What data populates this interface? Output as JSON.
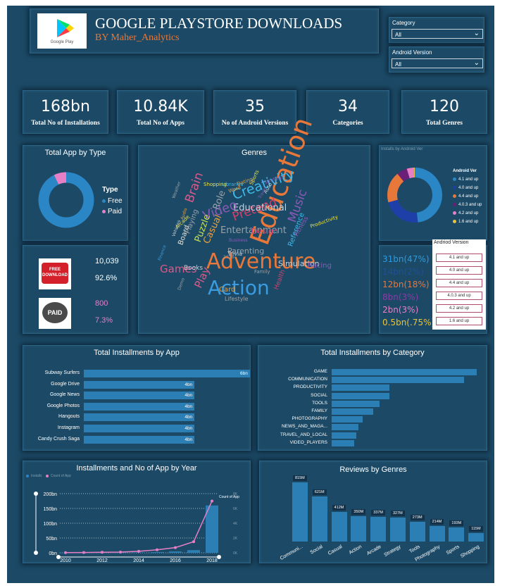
{
  "header": {
    "title": "GOOGLE PLAYSTORE DOWNLOADS",
    "subtitle": "BY Maher_Analytics",
    "logo_text": "Google Play"
  },
  "slicers": {
    "category_label": "Category",
    "category_value": "All",
    "android_label": "Android Version",
    "android_value": "All"
  },
  "kpis": [
    {
      "value": "168bn",
      "label": "Total No of Installations"
    },
    {
      "value": "10.84K",
      "label": "Total No of Apps"
    },
    {
      "value": "35",
      "label": "No of Android Versions"
    },
    {
      "value": "34",
      "label": "Categories"
    },
    {
      "value": "120",
      "label": "Total Genres"
    }
  ],
  "app_type": {
    "title": "Total App by Type",
    "legend_title": "Type",
    "free_label": "Free",
    "paid_label": "Paid",
    "free_color": "#2b86c5",
    "paid_color": "#e77fc7",
    "free_count": "10,039",
    "free_pct": "92.6%",
    "paid_count": "800",
    "paid_pct": "7.3%",
    "free_badge": "FREE DOWNLOAD",
    "paid_badge": "PAID"
  },
  "genres": {
    "title": "Genres",
    "words": [
      {
        "t": "Education",
        "c": "#e8773a"
      },
      {
        "t": "Adventure",
        "c": "#e8773a"
      },
      {
        "t": "Action",
        "c": "#3a9be0"
      },
      {
        "t": "Creativity",
        "c": "#3fb8e8"
      },
      {
        "t": "Pretend",
        "c": "#d63f6a"
      },
      {
        "t": "Educational",
        "c": "#c8d0d8"
      },
      {
        "t": "Video",
        "c": "#8a5ab8"
      },
      {
        "t": "Brain",
        "c": "#d85a8a"
      },
      {
        "t": "Games",
        "c": "#d85a8a"
      },
      {
        "t": "Play",
        "c": "#d85a8a"
      },
      {
        "t": "Entertainment",
        "c": "#9aa0a8"
      },
      {
        "t": "Music",
        "c": "#8a5ab8"
      },
      {
        "t": "Puzzle",
        "c": "#c8e050"
      },
      {
        "t": "Simulation",
        "c": "#c8d0d8"
      },
      {
        "t": "Casual",
        "c": "#e8a040"
      },
      {
        "t": "Role",
        "c": "#9aa0a8"
      },
      {
        "t": "Board",
        "c": "#e8e0d0"
      },
      {
        "t": "Playing",
        "c": "#9aa0a8"
      },
      {
        "t": "Parenting",
        "c": "#9aa0a8"
      },
      {
        "t": "Design",
        "c": "#d63f6a"
      },
      {
        "t": "Books",
        "c": "#c8d0d8"
      },
      {
        "t": "Racing",
        "c": "#8a5ab8"
      },
      {
        "t": "Reference",
        "c": "#3fb8e8"
      },
      {
        "t": "Fitness",
        "c": "#8a5ab8"
      },
      {
        "t": "Card",
        "c": "#e8a040"
      },
      {
        "t": "Lifestyle",
        "c": "#9aa0a8"
      },
      {
        "t": "Health",
        "c": "#d63f6a"
      },
      {
        "t": "Productivity",
        "c": "#e8e050"
      },
      {
        "t": "Trivia",
        "c": "#c8d0d8"
      },
      {
        "t": "Word",
        "c": "#e8a040"
      },
      {
        "t": "Shopping",
        "c": "#e8e050"
      },
      {
        "t": "Libraries",
        "c": "#3fb8e8"
      },
      {
        "t": "Dating",
        "c": "#e8a040"
      },
      {
        "t": "Sports",
        "c": "#e8e050"
      },
      {
        "t": "Strategy",
        "c": "#8a5ab8"
      },
      {
        "t": "Auto",
        "c": "#c8d0d8"
      },
      {
        "t": "Family",
        "c": "#9aa0a8"
      },
      {
        "t": "Arcade",
        "c": "#e8e050"
      },
      {
        "t": "Audio",
        "c": "#e8a040"
      },
      {
        "t": "Vehicles",
        "c": "#c8d0d8"
      },
      {
        "t": "Demo",
        "c": "#9aa0a8"
      },
      {
        "t": "Business",
        "c": "#8a5ab8"
      },
      {
        "t": "Travel",
        "c": "#8a5ab8"
      },
      {
        "t": "Finance",
        "c": "#3a9be0"
      },
      {
        "t": "Weather",
        "c": "#9aa0a8"
      },
      {
        "t": "2018",
        "c": "#9aa0a8"
      }
    ]
  },
  "android_donut": {
    "title": "Installs by Android Ver",
    "legend_title": "Android Ver",
    "items": [
      {
        "label": "4.1 and up",
        "color": "#2b86c5",
        "value": 47
      },
      {
        "label": "4.0 and up",
        "color": "#1f3fa8",
        "value": 22
      },
      {
        "label": "4.4 and up",
        "color": "#e8773a",
        "value": 18
      },
      {
        "label": "4.0.3 and up",
        "color": "#6a1f78",
        "value": 6
      },
      {
        "label": "4.2 and up",
        "color": "#e77fc7",
        "value": 4
      },
      {
        "label": "1.6 and up",
        "color": "#e8c43a",
        "value": 0.75
      }
    ]
  },
  "android_slicer": {
    "title": "Andriod Version",
    "options": [
      "4.1 and up",
      "4.0 and up",
      "4.4 and up",
      "4.0.3 and up",
      "4.2 and up",
      "1.6 and up"
    ]
  },
  "android_shares": [
    {
      "text": "31bn(47%)",
      "color": "#2b9be0"
    },
    {
      "text": "14bn(2%)",
      "color": "#1f4f9a"
    },
    {
      "text": "12bn(18%)",
      "color": "#e8773a"
    },
    {
      "text": "8bn(3%)",
      "color": "#8a3aa8"
    },
    {
      "text": "2bn(3%)",
      "color": "#e77fc7"
    },
    {
      "text": "0.5bn(.75%)",
      "color": "#e8c43a"
    }
  ],
  "chart_data": [
    {
      "type": "bar",
      "orientation": "horizontal",
      "title": "Total Installments by App",
      "categories": [
        "Subway Surfers",
        "Google Drive",
        "Google News",
        "Google Photos",
        "Hangouts",
        "Instagram",
        "Candy Crush Saga"
      ],
      "values": [
        6,
        4,
        4,
        4,
        4,
        4,
        4
      ],
      "value_labels": [
        "6bn",
        "4bn",
        "4bn",
        "4bn",
        "4bn",
        "4bn",
        "4bn"
      ],
      "xlim": [
        0,
        6
      ]
    },
    {
      "type": "bar",
      "orientation": "horizontal",
      "title": "Total Installments by Category",
      "categories": [
        "GAME",
        "COMMUNICATION",
        "PRODUCTIVITY",
        "SOCIAL",
        "TOOLS",
        "FAMILY",
        "PHOTOGRAPHY",
        "NEWS_AND_MAGA...",
        "TRAVEL_AND_LOCAL",
        "VIDEO_PLAYERS"
      ],
      "values": [
        35,
        32,
        14,
        14,
        11.5,
        10,
        7.5,
        6.5,
        6,
        5.5
      ],
      "xlim": [
        0,
        35
      ]
    },
    {
      "type": "bar",
      "title": "Installments and No of App by Year",
      "legend": [
        "Installs",
        "Count of App"
      ],
      "x": [
        2010,
        2011,
        2012,
        2013,
        2014,
        2015,
        2016,
        2017,
        2018
      ],
      "installs": [
        0.3,
        0.5,
        0.6,
        0.9,
        1.3,
        2.2,
        4.5,
        9,
        160
      ],
      "count_of_app": [
        20,
        30,
        70,
        100,
        200,
        400,
        700,
        1500,
        7000
      ],
      "yticks": [
        "0bn",
        "50bn",
        "100bn",
        "150bn",
        "200bn"
      ],
      "y2ticks": [
        "0K",
        "2K",
        "4K",
        "6K",
        "8K"
      ],
      "xticks": [
        "2010",
        "2012",
        "2014",
        "2016",
        "2018"
      ],
      "ylim": [
        0,
        200
      ],
      "y2lim": [
        0,
        8000
      ],
      "annotation": "Count of App"
    },
    {
      "type": "bar",
      "title": "Reviews by Genres",
      "categories": [
        "Communi...",
        "Social",
        "Casual",
        "Action",
        "Arcade",
        "Strategy",
        "Tools",
        "Photography",
        "Sports",
        "Shopping"
      ],
      "values": [
        815,
        621,
        412,
        350,
        337,
        327,
        273,
        214,
        193,
        115
      ],
      "value_labels": [
        "815M",
        "621M",
        "412M",
        "350M",
        "337M",
        "327M",
        "273M",
        "214M",
        "193M",
        "115M"
      ],
      "ylim": [
        0,
        815
      ]
    }
  ]
}
